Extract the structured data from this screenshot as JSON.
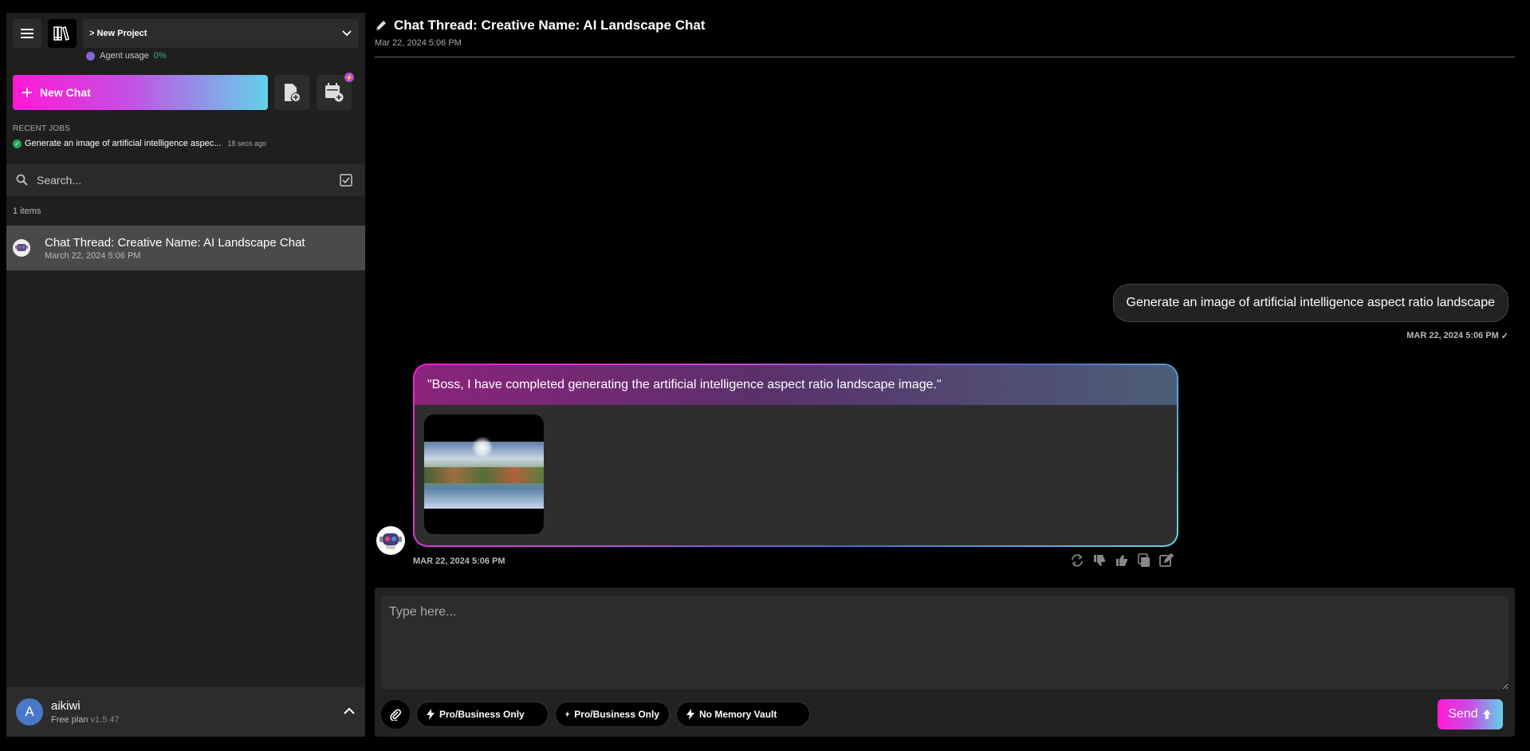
{
  "sidebar": {
    "project": "> New Project",
    "agent_usage_label": "Agent usage",
    "agent_usage_value": "0%",
    "new_chat_label": "New Chat",
    "recent_jobs_label": "RECENT JOBS",
    "recent_job": {
      "text": "Generate an image of artificial intelligence aspec...",
      "time": "18 secs ago"
    },
    "search_placeholder": "Search...",
    "items_count": "1 items",
    "threads": [
      {
        "title": "Chat Thread: Creative Name: AI Landscape Chat",
        "date": "March 22, 2024 5:06 PM"
      }
    ],
    "user": {
      "initial": "A",
      "name": "aikiwi",
      "plan": "Free plan",
      "version": "v1.5.47"
    }
  },
  "header": {
    "title": "Chat Thread: Creative Name: AI Landscape Chat",
    "date": "Mar 22, 2024 5:06 PM"
  },
  "messages": {
    "user": {
      "text": "Generate an image of artificial intelligence aspect ratio landscape",
      "time": "MAR 22, 2024 5:06 PM"
    },
    "bot": {
      "text": "\"Boss, I have completed generating the artificial intelligence aspect ratio landscape image.\"",
      "time": "MAR 22, 2024 5:06 PM"
    }
  },
  "composer": {
    "placeholder": "Type here...",
    "chips": [
      "Pro/Business Only",
      "Pro/Business Only",
      "No Memory Vault"
    ],
    "send_label": "Send"
  },
  "colors": {
    "accent_pink": "#ff19d5",
    "accent_cyan": "#62d2e8",
    "success": "#24a85a",
    "user_avatar": "#4a78c8"
  }
}
